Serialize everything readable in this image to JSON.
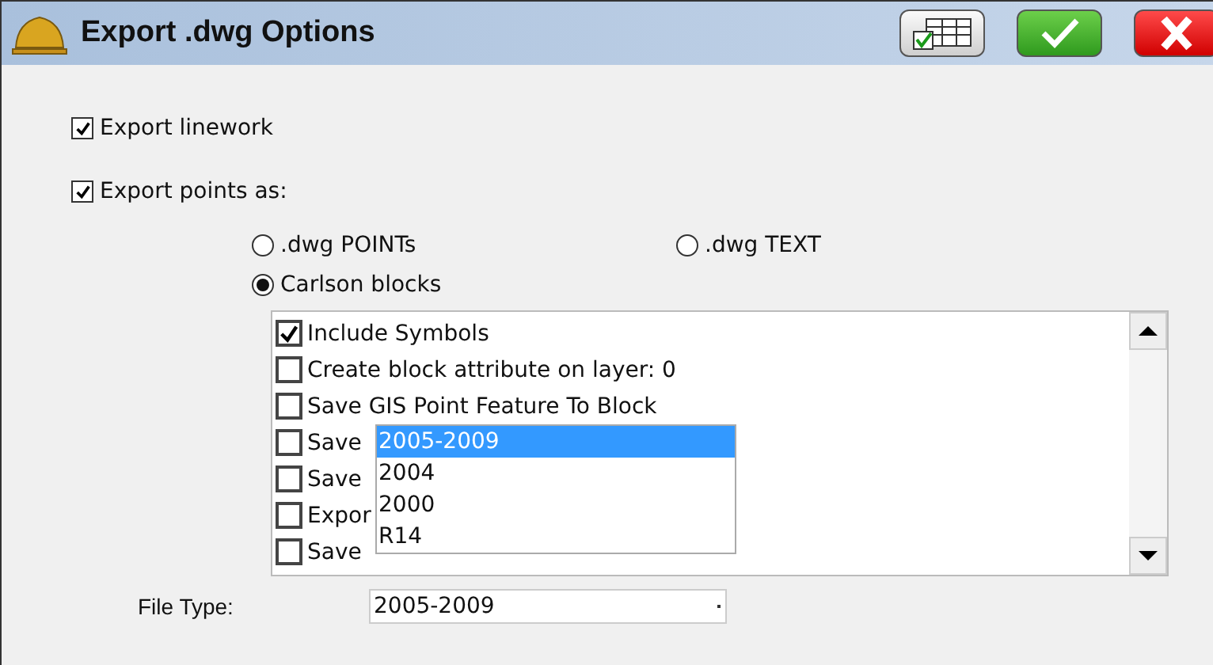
{
  "window": {
    "title": "Export .dwg Options"
  },
  "toolbar": [
    {
      "kind": "table"
    },
    {
      "kind": "ok"
    },
    {
      "kind": "cancel"
    }
  ],
  "options": [
    {
      "label": "Export linework",
      "checked": true
    },
    {
      "label": "Export points as:",
      "checked": true
    }
  ],
  "point_format": [
    {
      "label": ".dwg POINTs",
      "selected": false
    },
    {
      "label": ".dwg TEXT",
      "selected": false
    },
    {
      "label": "Carlson blocks",
      "selected": true
    }
  ],
  "block_options": [
    {
      "label": "Include Symbols",
      "checked": true
    },
    {
      "label": "Create block attribute on layer: 0",
      "checked": false
    },
    {
      "label": "Save GIS Point Feature To Block",
      "checked": false
    },
    {
      "label": "Save",
      "checked": false
    },
    {
      "label": "Save",
      "checked": false
    },
    {
      "label": "Expor",
      "checked": false
    },
    {
      "label": "Save",
      "checked": false
    }
  ],
  "file_type": {
    "label": "File Type:",
    "value": "2005-2009",
    "options": [
      {
        "label": "2005-2009",
        "selected": true
      },
      {
        "label": "2004",
        "selected": false
      },
      {
        "label": "2000",
        "selected": false
      },
      {
        "label": "R14",
        "selected": false
      }
    ]
  }
}
